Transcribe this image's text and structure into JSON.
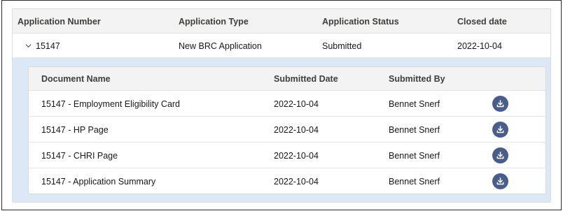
{
  "table": {
    "headers": {
      "app_number": "Application Number",
      "app_type": "Application Type",
      "app_status": "Application Status",
      "closed_date": "Closed date"
    },
    "row": {
      "app_number": "15147",
      "app_type": "New BRC Application",
      "app_status": "Submitted",
      "closed_date": "2022-10-04"
    }
  },
  "documents": {
    "headers": {
      "name": "Document Name",
      "submitted_date": "Submitted Date",
      "submitted_by": "Submitted By"
    },
    "rows": [
      {
        "name": "15147 - Employment Eligibility Card",
        "submitted_date": "2022-10-04",
        "submitted_by": "Bennet Snerf"
      },
      {
        "name": "15147 - HP Page",
        "submitted_date": "2022-10-04",
        "submitted_by": "Bennet Snerf"
      },
      {
        "name": "15147 - CHRI Page",
        "submitted_date": "2022-10-04",
        "submitted_by": "Bennet Snerf"
      },
      {
        "name": "15147 - Application Summary",
        "submitted_date": "2022-10-04",
        "submitted_by": "Bennet Snerf"
      }
    ]
  },
  "icons": {
    "expand": "chevron-down-icon",
    "download": "download-icon"
  },
  "colors": {
    "expanded_background": "#dce8f6",
    "download_button": "#4a5d8a",
    "header_background": "#f3f3f3"
  }
}
